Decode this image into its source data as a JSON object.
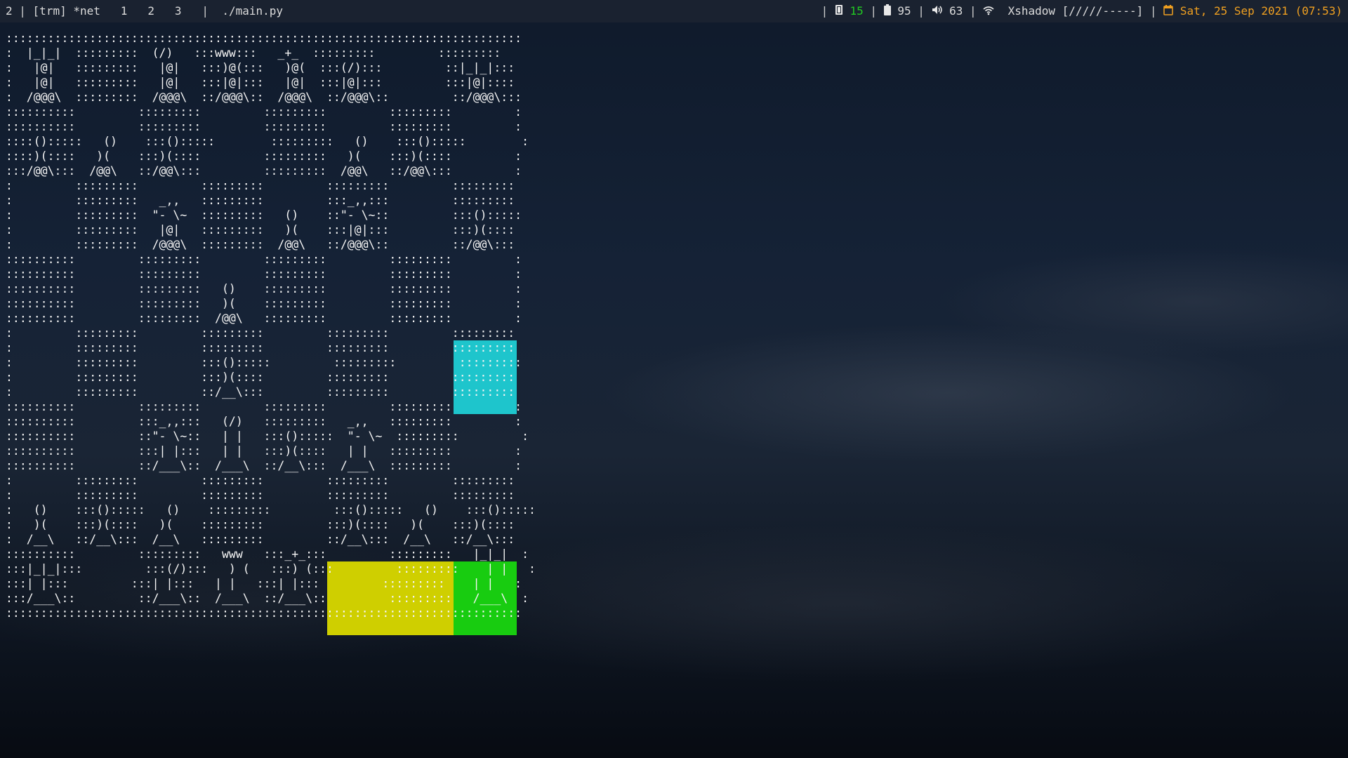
{
  "statusbar": {
    "workspace": "2",
    "layout": "[trm]",
    "active_tag": "*net",
    "tags": [
      "1",
      "2",
      "3"
    ],
    "window_title": "./main.py",
    "cpu_value": "15",
    "battery_value": "95",
    "volume_value": "63",
    "wifi_name": "Xshadow",
    "wifi_strength": "[/////-----]",
    "datetime": "Sat, 25 Sep 2021 (07:53)",
    "colors": {
      "cpu": "#22cc22",
      "clock": "#f0a020"
    },
    "icons": [
      "memory-icon",
      "battery-icon",
      "volume-icon",
      "wifi-icon",
      "calendar-icon"
    ]
  },
  "terminal": {
    "board_lines": [
      "::::::::::::::::::::::::::::::::::::::::::::::::::::::::::::::::::::::::::",
      ":  |_|_|  :::::::::  (/)   :::www:::   _+_  :::::::::         :::::::::",
      ":   |@|   :::::::::   |@|   :::)@(:::   )@(  :::(/):::         ::|_|_|:::",
      ":   |@|   :::::::::   |@|   :::|@|:::   |@|  :::|@|:::         :::|@|::::",
      ":  /@@@\\  :::::::::  /@@@\\  ::/@@@\\::  /@@@\\  ::/@@@\\::         ::/@@@\\:::",
      "::::::::::         :::::::::         :::::::::         :::::::::         :",
      "::::::::::         :::::::::         :::::::::         :::::::::         :",
      "::::():::::   ()    :::():::::        :::::::::   ()    :::():::::        :",
      "::::)(::::   )(    :::)(::::         :::::::::   )(    :::)(::::         :",
      ":::/@@\\:::  /@@\\   ::/@@\\:::         :::::::::  /@@\\   ::/@@\\:::         :",
      ":         :::::::::         :::::::::         :::::::::         :::::::::",
      ":         :::::::::   _,,   :::::::::         :::_,,:::         :::::::::",
      ":         :::::::::  \"- \\~  :::::::::   ()    ::\"- \\~::         :::():::::",
      ":         :::::::::   |@|   :::::::::   )(    :::|@|:::         :::)(::::",
      ":         :::::::::  /@@@\\  :::::::::  /@@\\   ::/@@@\\::         ::/@@\\:::",
      "::::::::::         :::::::::         :::::::::         :::::::::         :",
      "::::::::::         :::::::::         :::::::::         :::::::::         :",
      "::::::::::         :::::::::   ()    :::::::::         :::::::::         :",
      "::::::::::         :::::::::   )(    :::::::::         :::::::::         :",
      "::::::::::         :::::::::  /@@\\   :::::::::         :::::::::         :",
      ":         :::::::::         :::::::::         :::::::::         :::::::::",
      ":         :::::::::         :::::::::         :::::::::         :::::::::",
      ":         :::::::::         :::():::::         :::::::::         :::::::::",
      ":         :::::::::         :::)(::::         :::::::::         :::::::::",
      ":         :::::::::         ::/__\\:::         :::::::::         :::::::::",
      "::::::::::         :::::::::         :::::::::         :::::::::         :",
      "::::::::::         :::_,,:::   (/)   :::::::::   _,,   :::::::::         :",
      "::::::::::         ::\"- \\~::   | |   :::():::::  \"- \\~  :::::::::         :",
      "::::::::::         :::| |:::   | |   :::)(::::   | |   :::::::::         :",
      "::::::::::         ::/___\\::  /___\\  ::/__\\:::  /___\\  :::::::::         :",
      ":         :::::::::         :::::::::         :::::::::         :::::::::",
      ":         :::::::::         :::::::::         :::::::::         :::::::::",
      ":   ()    :::():::::   ()    :::::::::         :::():::::   ()    :::():::::",
      ":   )(    :::)(::::   )(    :::::::::         :::)(::::   )(    :::)(::::",
      ":  /__\\   ::/__\\:::  /__\\   :::::::::         ::/__\\:::  /__\\   ::/__\\:::",
      "::::::::::         :::::::::   www   :::_+_:::         :::::::::   |_|_|  :",
      ":::|_|_|:::         :::(/):::   ) (   :::) (:::         :::::::::    | |   :",
      ":::| |:::         :::| |:::   | |   :::| |:::         :::::::::    | |   :",
      ":::/___\\::         ::/___\\::  /___\\  ::/___\\::         :::::::::   /___\\  :",
      "::::::::::::::::::::::::::::::::::::::::::::::::::::::::::::::::::::::::::"
    ]
  }
}
